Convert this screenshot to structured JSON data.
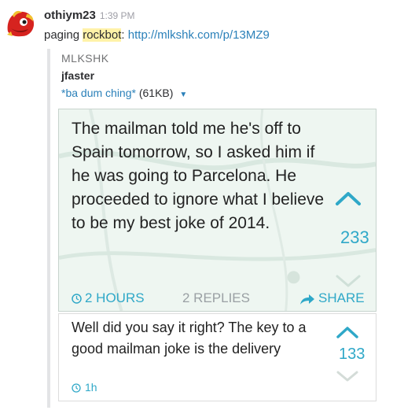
{
  "message": {
    "author": "othiym23",
    "time": "1:39 PM",
    "text_prefix": "paging ",
    "mention": "rockbot",
    "text_sep": ": ",
    "link": "http://mlkshk.com/p/13MZ9"
  },
  "attachment": {
    "source": "MLKSHK",
    "author": "jfaster",
    "file_name": "*ba dum ching*",
    "file_size": "(61KB)",
    "card": {
      "text": "The mailman told me he's off to Spain tomorrow, so I asked him if he was going to Parcelona. He proceeded to ignore what I believe to be my best joke of 2014.",
      "votes": "233",
      "age": "2 HOURS",
      "replies": "2 REPLIES",
      "share": "SHARE"
    },
    "reply": {
      "text": "Well did you say it right? The key to a good mailman joke is the delivery",
      "votes": "133",
      "age": "1h"
    }
  },
  "colors": {
    "accent": "#2fa8c8",
    "link": "#2a80b9",
    "mention_highlight": "#fff2a8"
  }
}
